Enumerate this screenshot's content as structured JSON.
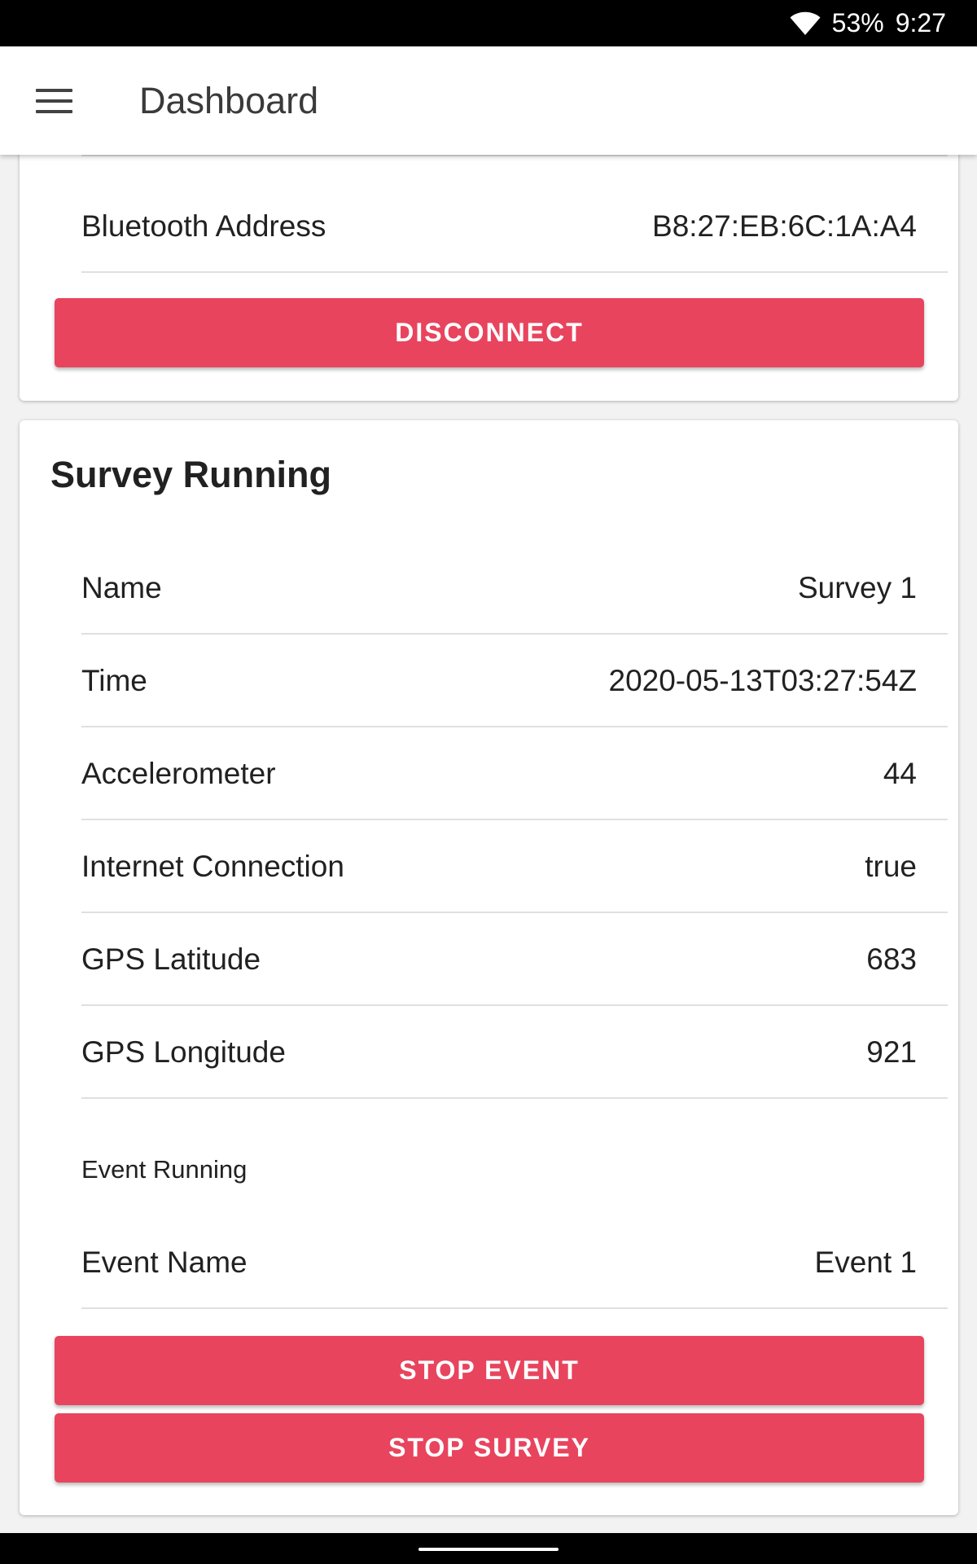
{
  "status_bar": {
    "battery": "53%",
    "time": "9:27"
  },
  "app_bar": {
    "title": "Dashboard"
  },
  "device_card": {
    "rows": [
      {
        "label": "Bluetooth Address",
        "value": "B8:27:EB:6C:1A:A4"
      }
    ],
    "disconnect_label": "DISCONNECT"
  },
  "survey_card": {
    "title": "Survey Running",
    "rows": [
      {
        "label": "Name",
        "value": "Survey 1"
      },
      {
        "label": "Time",
        "value": "2020-05-13T03:27:54Z"
      },
      {
        "label": "Accelerometer",
        "value": "44"
      },
      {
        "label": "Internet Connection",
        "value": "true"
      },
      {
        "label": "GPS Latitude",
        "value": "683"
      },
      {
        "label": "GPS Longitude",
        "value": "921"
      }
    ],
    "event_heading": "Event Running",
    "event_rows": [
      {
        "label": "Event Name",
        "value": "Event 1"
      }
    ],
    "stop_event_label": "STOP EVENT",
    "stop_survey_label": "STOP SURVEY"
  },
  "colors": {
    "accent": "#e8445e",
    "app_bar_bg": "#ffffff",
    "status_bar_bg": "#000000"
  },
  "icons": {
    "menu": "hamburger-menu-icon",
    "wifi": "wifi-icon"
  }
}
